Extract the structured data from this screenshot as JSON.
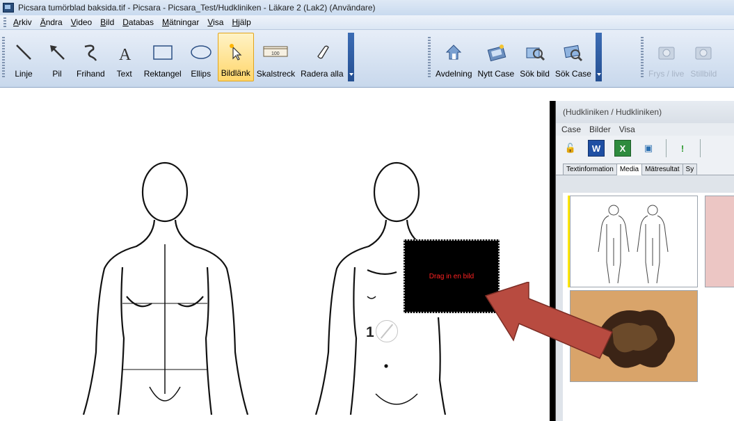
{
  "window": {
    "title": "Picsara tumörblad baksida.tif - Picsara - Picsara_Test/Hudkliniken - Läkare 2  (Lak2) (Användare)"
  },
  "menu": {
    "items": [
      "Arkiv",
      "Ändra",
      "Video",
      "Bild",
      "Databas",
      "Mätningar",
      "Visa",
      "Hjälp"
    ]
  },
  "toolbar": {
    "drawing_tools": [
      {
        "label": "Linje",
        "icon": "line-icon"
      },
      {
        "label": "Pil",
        "icon": "arrow-icon"
      },
      {
        "label": "Frihand",
        "icon": "freehand-icon"
      },
      {
        "label": "Text",
        "icon": "text-icon"
      },
      {
        "label": "Rektangel",
        "icon": "rectangle-icon"
      },
      {
        "label": "Ellips",
        "icon": "ellipse-icon"
      },
      {
        "label": "Bildlänk",
        "icon": "image-link-icon",
        "active": true
      },
      {
        "label": "Skalstreck",
        "icon": "scale-bar-icon"
      },
      {
        "label": "Radera alla",
        "icon": "eraser-icon"
      }
    ],
    "case_tools": [
      {
        "label": "Avdelning",
        "icon": "department-icon"
      },
      {
        "label": "Nytt Case",
        "icon": "new-case-icon"
      },
      {
        "label": "Sök bild",
        "icon": "search-image-icon"
      },
      {
        "label": "Sök Case",
        "icon": "search-case-icon"
      }
    ],
    "camera_tools": [
      {
        "label": "Frys / live",
        "icon": "camera-freeze-icon",
        "disabled": true
      },
      {
        "label": "Stillbild",
        "icon": "camera-still-icon",
        "disabled": true
      }
    ],
    "scale_bar_text": "100"
  },
  "canvas": {
    "drop_target_text": "Drag in en bild",
    "marker_number": "1"
  },
  "case_window": {
    "title": "(Hudkliniken / Hudkliniken)",
    "menu": [
      "Case",
      "Bilder",
      "Visa"
    ],
    "toolbar": [
      {
        "icon": "lock-icon",
        "glyph": "🔓"
      },
      {
        "icon": "word-icon",
        "glyph": "W"
      },
      {
        "icon": "excel-icon",
        "glyph": "X"
      },
      {
        "icon": "presentation-icon",
        "glyph": "▣"
      },
      {
        "icon": "exclamation-icon",
        "glyph": "!"
      }
    ],
    "tabs": [
      {
        "label": "Textinformation"
      },
      {
        "label": "Media",
        "selected": true
      },
      {
        "label": "Mätresultat"
      },
      {
        "label": "Sy"
      }
    ]
  },
  "colors": {
    "accent": "#ffd66b",
    "drop_target_text": "#ff2222",
    "arrow": "#b84b40"
  }
}
